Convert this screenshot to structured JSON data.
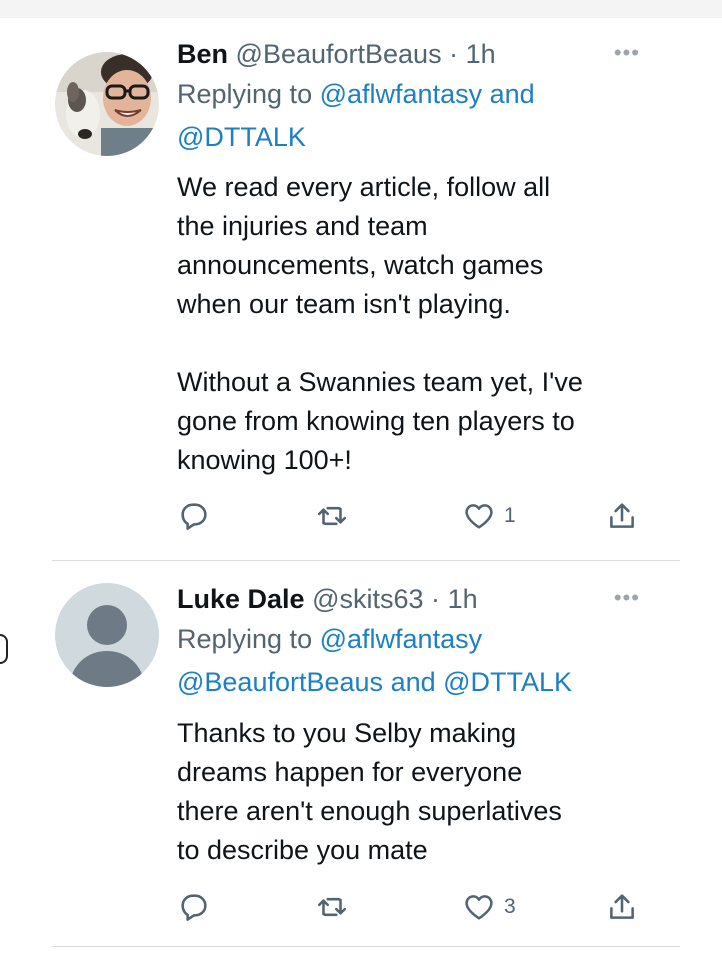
{
  "tweets": [
    {
      "name": "Ben",
      "handle": "@BeaufortBeaus",
      "separator": "·",
      "time": "1h",
      "replying_prefix": "Replying to",
      "mentions": [
        "@aflwfantasy",
        "@DTTALK"
      ],
      "joiners": [
        "and"
      ],
      "body": [
        "We read every article, follow all",
        "the injuries and team",
        "announcements, watch games",
        "when our team isn't playing.",
        "",
        "Without a Swannies team yet, I've",
        "gone from knowing ten players to",
        "knowing 100+!"
      ],
      "like_count": "1"
    },
    {
      "name": "Luke Dale",
      "handle": "@skits63",
      "separator": "·",
      "time": "1h",
      "replying_prefix": "Replying to",
      "mentions": [
        "@aflwfantasy",
        "@BeaufortBeaus",
        "@DTTALK"
      ],
      "joiners": [
        "and"
      ],
      "body": [
        "Thanks to you Selby making",
        "dreams happen for everyone",
        "there aren't enough superlatives",
        "to describe you mate"
      ],
      "like_count": "3"
    }
  ],
  "more_glyph": "•••",
  "colors": {
    "link": "#1d7fc4",
    "secondary_text": "#536471",
    "primary_text": "#0f1419"
  },
  "icons": [
    "reply-icon",
    "retweet-icon",
    "like-icon",
    "share-icon",
    "more-icon"
  ]
}
